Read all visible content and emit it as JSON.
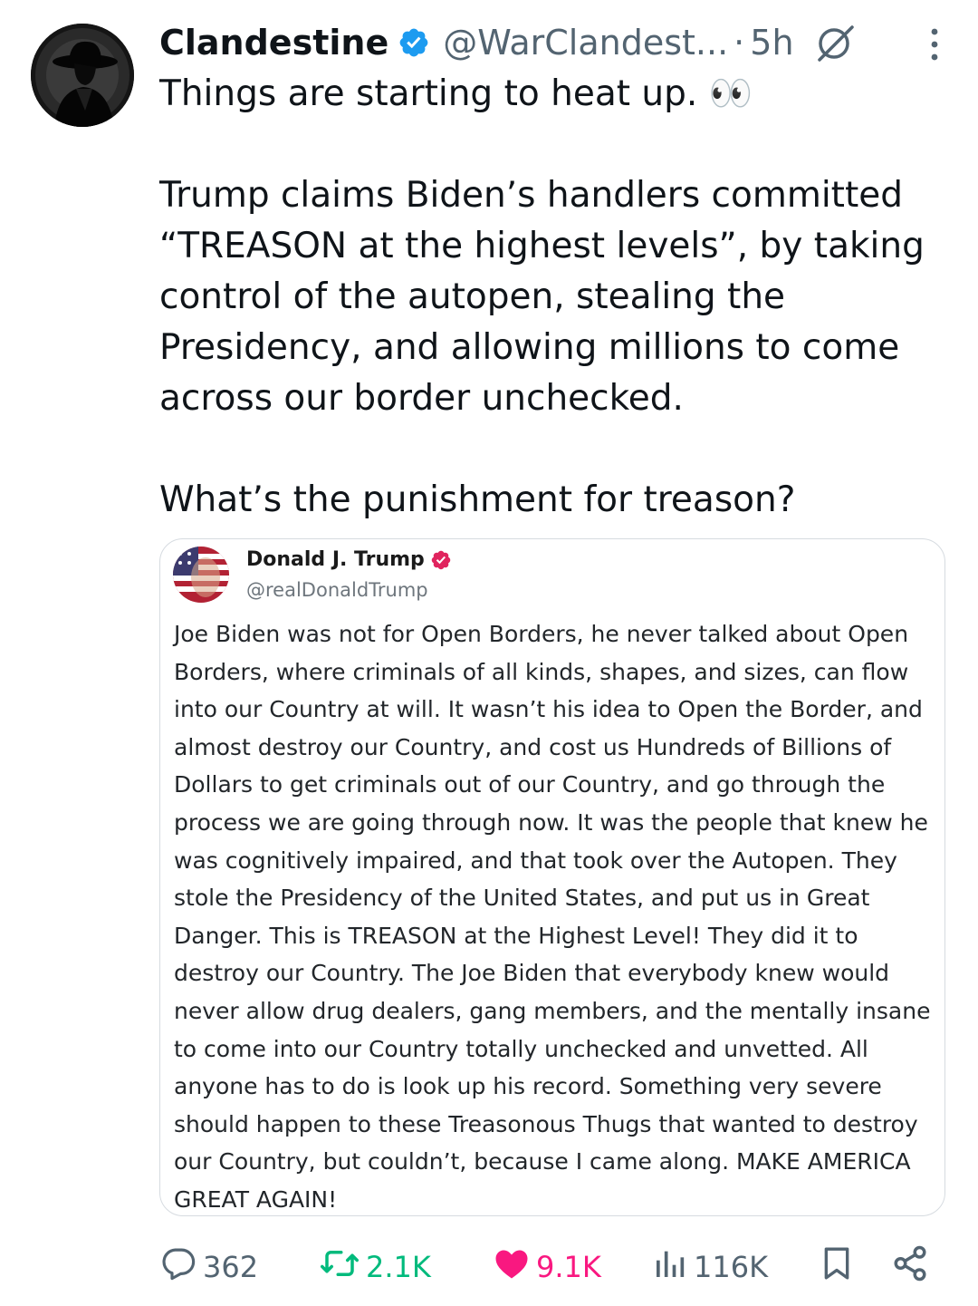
{
  "tweet": {
    "author_name": "Clandestine",
    "handle": "@WarClandest...",
    "separator": "·",
    "time": "5h",
    "text": [
      "Things are starting to heat up. 👀",
      "",
      "Trump claims Biden’s handlers committed “TREASON at the highest levels”, by taking control of the autopen, stealing the Presidency, and allowing millions to come across our border unchecked.",
      "",
      "What’s the punishment for treason?"
    ]
  },
  "quoted": {
    "author_name": "Donald J. Trump",
    "handle": "@realDonaldTrump",
    "text": "Joe Biden was not for Open Borders, he never talked about Open Borders, where criminals of all kinds, shapes, and sizes, can flow into our Country at will. It wasn’t his idea to Open the Border, and almost destroy our Country, and cost us Hundreds of Billions of Dollars to get criminals out of our Country, and go through the process we are going through now. It was the people that knew he was cognitively impaired, and that took over the Autopen. They stole the Presidency of the United States, and put us in Great Danger. This is TREASON at the Highest Level! They did it to destroy our Country. The Joe Biden that everybody knew would never allow drug dealers, gang members, and the mentally insane to come into our Country totally unchecked and unvetted. All anyone has to do is look up his record. Something very severe should happen to these Treasonous Thugs that wanted to destroy our Country, but couldn’t, because I came along. MAKE AMERICA GREAT AGAIN!"
  },
  "actions": {
    "replies": "362",
    "reposts": "2.1K",
    "likes": "9.1K",
    "views": "116K"
  },
  "icons": {
    "verified": "verified-badge-icon",
    "grok": "grok-icon",
    "more": "more-options-icon",
    "reply": "reply-icon",
    "repost": "repost-icon",
    "like": "heart-icon",
    "views": "views-icon",
    "bookmark": "bookmark-icon",
    "share": "share-icon"
  },
  "colors": {
    "verified": "#1d9bf0",
    "quote_verified": "#e0245e",
    "like": "#f91880",
    "repost": "#00ba7c",
    "muted": "#536471"
  }
}
